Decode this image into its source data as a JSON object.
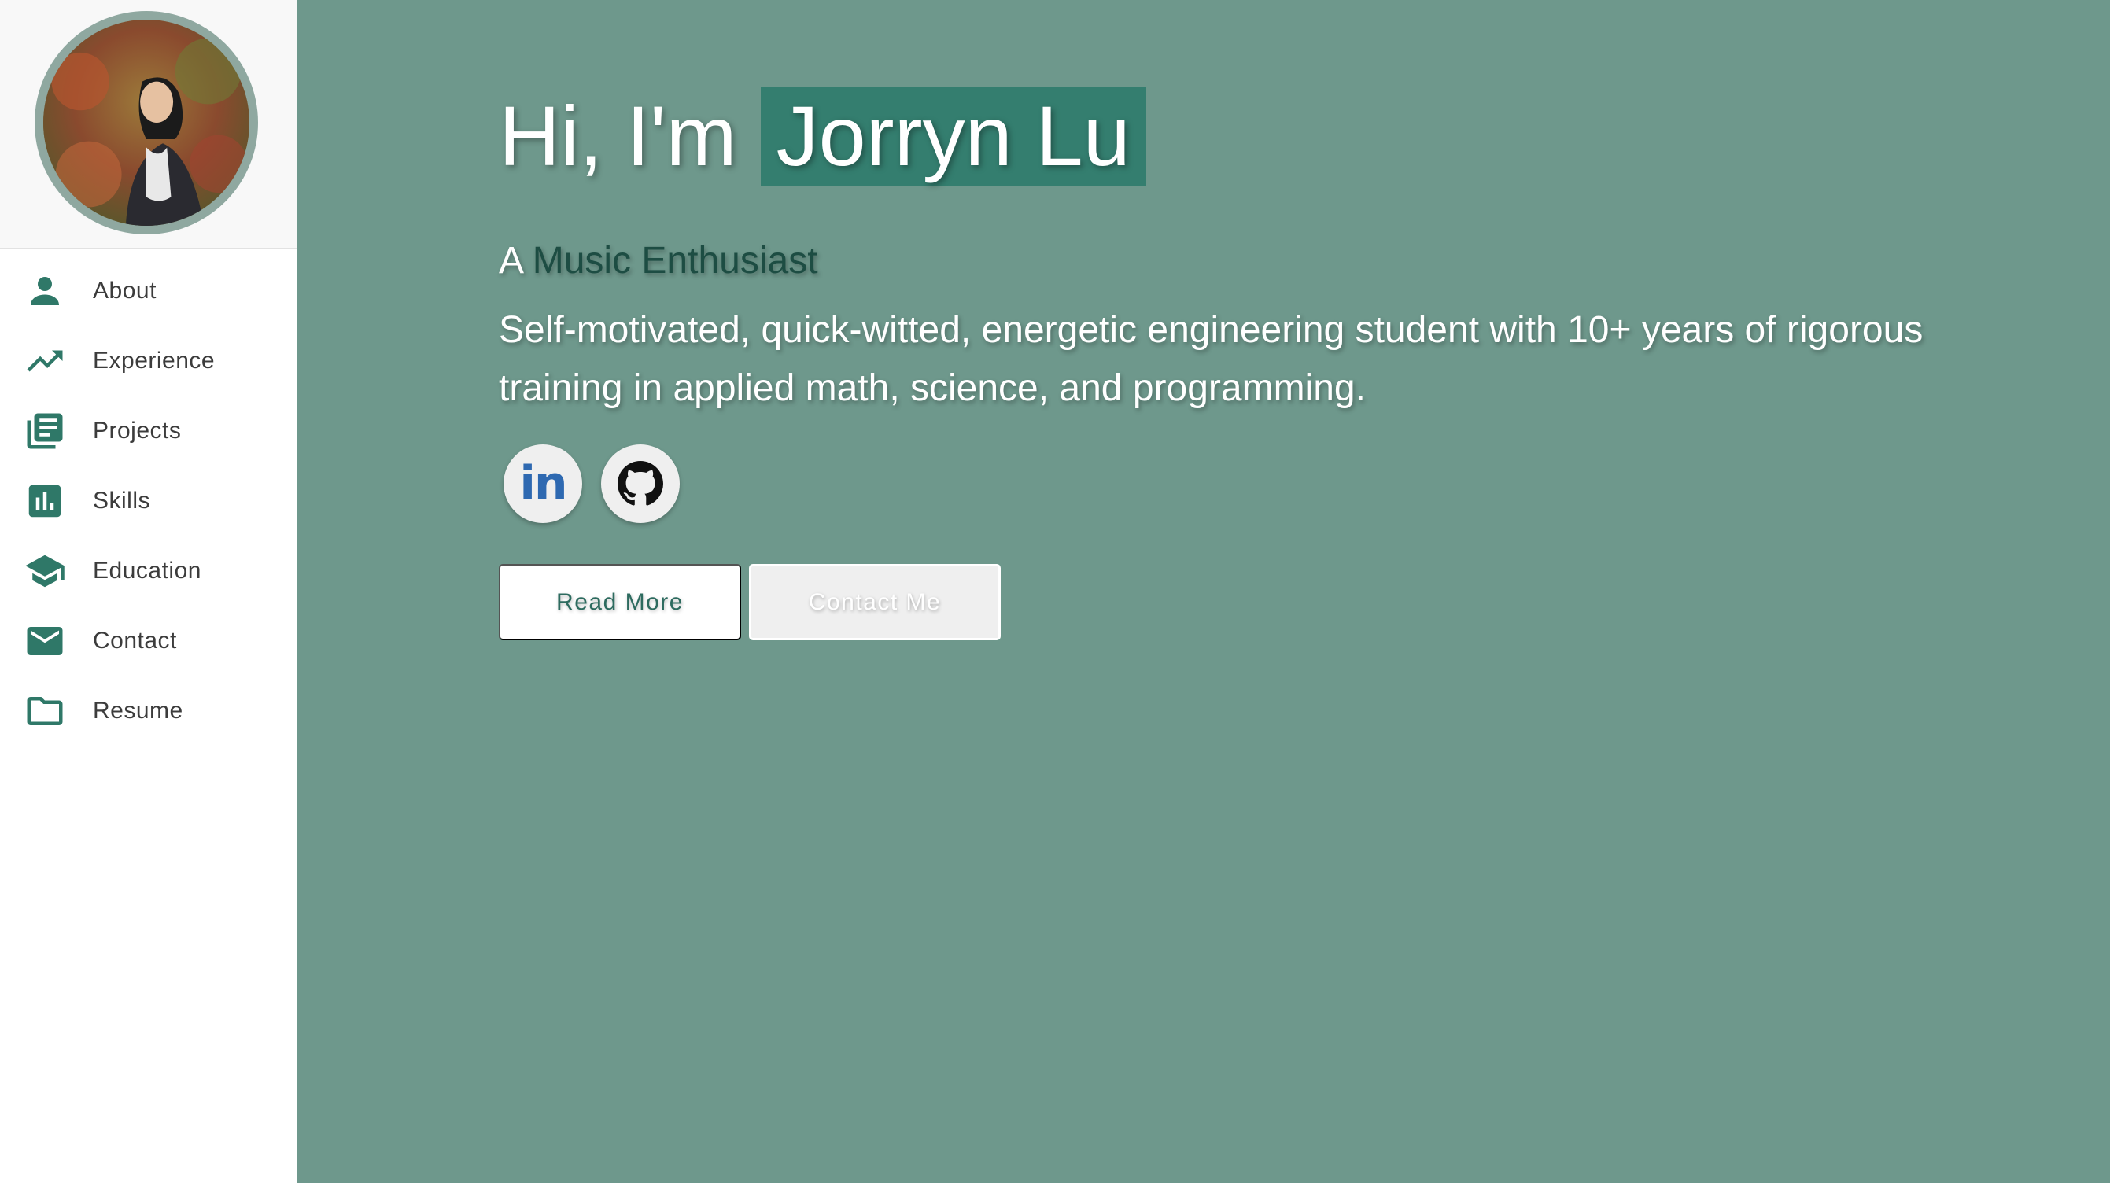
{
  "sidebar": {
    "items": [
      {
        "label": "About",
        "icon": "person-icon"
      },
      {
        "label": "Experience",
        "icon": "trending-up-icon"
      },
      {
        "label": "Projects",
        "icon": "documents-icon"
      },
      {
        "label": "Skills",
        "icon": "bar-chart-icon"
      },
      {
        "label": "Education",
        "icon": "graduation-cap-icon"
      },
      {
        "label": "Contact",
        "icon": "mail-icon"
      },
      {
        "label": "Resume",
        "icon": "folder-icon"
      }
    ]
  },
  "hero": {
    "greeting": "Hi, I'm",
    "name": "Jorryn Lu",
    "tagline_prefix": "A",
    "role": "Music Enthusiast",
    "bio": "Self-motivated, quick-witted, energetic engineering student with 10+ years of rigorous training in applied math, science, and programming.",
    "socials": [
      {
        "name": "linkedin",
        "text": "in"
      },
      {
        "name": "github"
      }
    ],
    "buttons": {
      "read_more": "Read More",
      "contact_me": "Contact Me"
    }
  },
  "colors": {
    "main_bg": "#6e988c",
    "accent": "#347e6f",
    "icon": "#2f7868",
    "role_text": "#1d4d43"
  }
}
